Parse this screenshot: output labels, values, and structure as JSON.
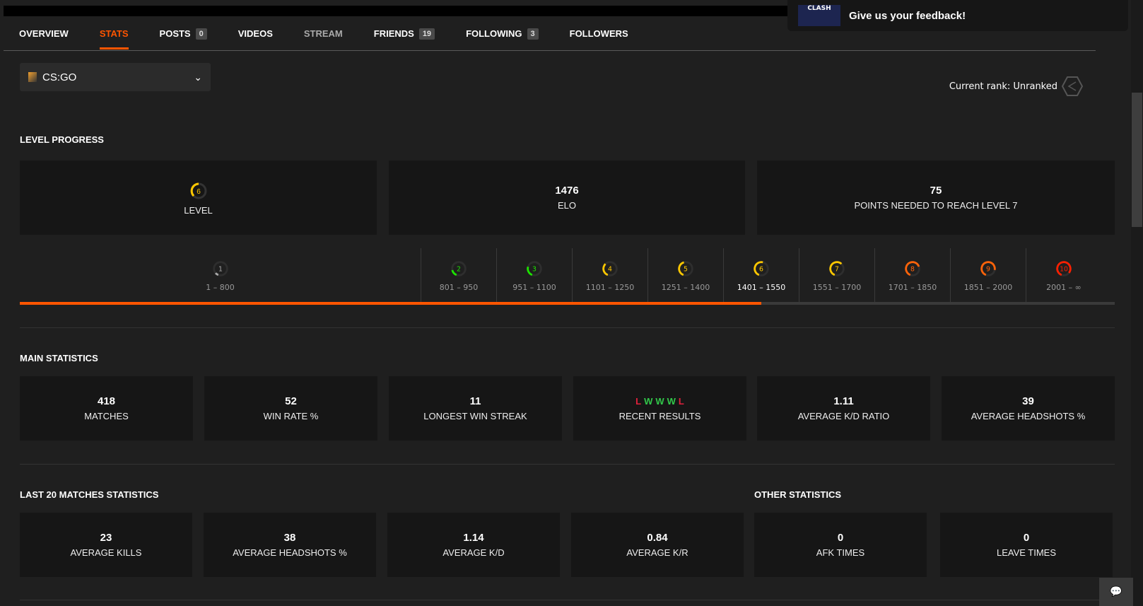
{
  "tabs": [
    {
      "label": "OVERVIEW"
    },
    {
      "label": "STATS",
      "active": true
    },
    {
      "label": "POSTS",
      "badge": "0"
    },
    {
      "label": "VIDEOS"
    },
    {
      "label": "STREAM"
    },
    {
      "label": "FRIENDS",
      "badge": "19"
    },
    {
      "label": "FOLLOWING",
      "badge": "3"
    },
    {
      "label": "FOLLOWERS"
    }
  ],
  "game_select": {
    "value": "CS:GO"
  },
  "rank": {
    "label": "Current rank: Unranked"
  },
  "notification": {
    "logo": "CLASH",
    "text": "Give us your feedback!"
  },
  "level_progress": {
    "title": "LEVEL PROGRESS",
    "level": "6",
    "level_label": "LEVEL",
    "elo": "1476",
    "elo_label": "ELO",
    "points": "75",
    "points_label": "POINTS NEEDED TO REACH LEVEL 7",
    "progress_elo": 1476
  },
  "levels": [
    {
      "n": "1",
      "range": "1 – 800",
      "color": "#aaaaaa"
    },
    {
      "n": "2",
      "range": "801 – 950",
      "color": "#1ce400"
    },
    {
      "n": "3",
      "range": "951 – 1100",
      "color": "#1ce400"
    },
    {
      "n": "4",
      "range": "1101 – 1250",
      "color": "#ffc800"
    },
    {
      "n": "5",
      "range": "1251 – 1400",
      "color": "#ffc800"
    },
    {
      "n": "6",
      "range": "1401 – 1550",
      "color": "#ffc800"
    },
    {
      "n": "7",
      "range": "1551 – 1700",
      "color": "#ffc800"
    },
    {
      "n": "8",
      "range": "1701 – 1850",
      "color": "#ff6309"
    },
    {
      "n": "9",
      "range": "1851 – 2000",
      "color": "#ff6309"
    },
    {
      "n": "10",
      "range": "2001 – ∞",
      "color": "#fe1f00"
    }
  ],
  "main": {
    "title": "MAIN STATISTICS",
    "items": [
      {
        "v": "418",
        "l": "MATCHES"
      },
      {
        "v": "52",
        "l": "WIN RATE %"
      },
      {
        "v": "11",
        "l": "LONGEST WIN STREAK"
      },
      {
        "v": "",
        "l": "RECENT RESULTS"
      },
      {
        "v": "1.11",
        "l": "AVERAGE K/D RATIO"
      },
      {
        "v": "39",
        "l": "AVERAGE HEADSHOTS %"
      }
    ],
    "recent": [
      "L",
      "W",
      "W",
      "W",
      "L"
    ]
  },
  "last20": {
    "title": "LAST 20 MATCHES STATISTICS",
    "items": [
      {
        "v": "23",
        "l": "AVERAGE KILLS"
      },
      {
        "v": "38",
        "l": "AVERAGE HEADSHOTS %"
      },
      {
        "v": "1.14",
        "l": "AVERAGE K/D"
      },
      {
        "v": "0.84",
        "l": "AVERAGE K/R"
      }
    ]
  },
  "other": {
    "title": "OTHER STATISTICS",
    "items": [
      {
        "v": "0",
        "l": "AFK TIMES"
      },
      {
        "v": "0",
        "l": "LEAVE TIMES"
      }
    ]
  },
  "colors": {
    "accent": "#ff5500",
    "win": "#32c84a",
    "loss": "#e0213c"
  }
}
